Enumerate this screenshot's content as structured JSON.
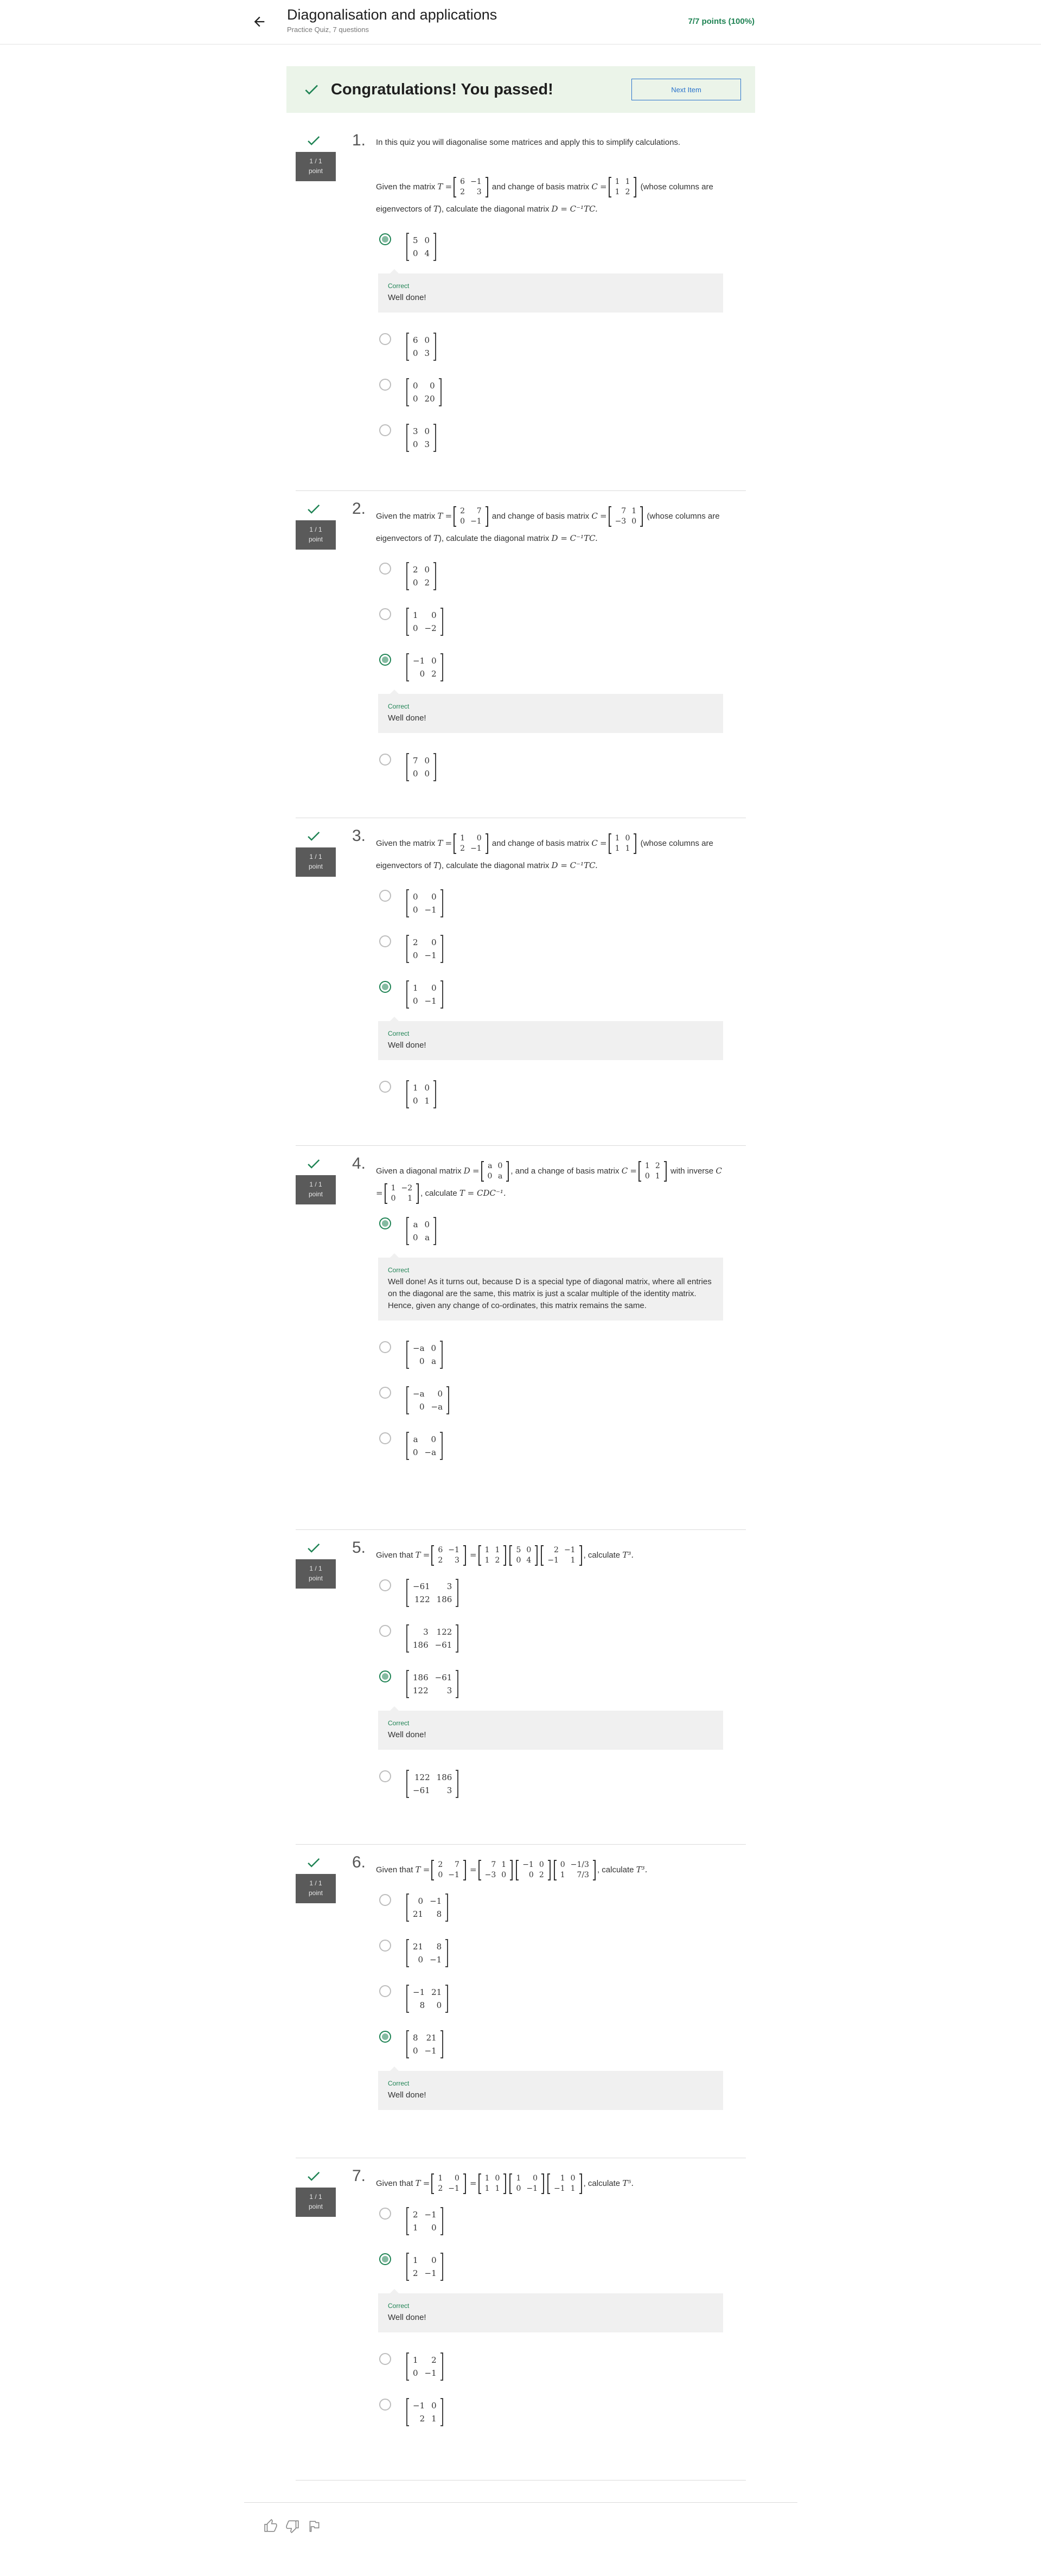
{
  "header": {
    "title": "Diagonalisation and applications",
    "subtitle": "Practice Quiz, 7 questions",
    "points": "7/7 points (100%)"
  },
  "banner": {
    "text": "Congratulations! You passed!",
    "next_label": "Next Item"
  },
  "point_label": "1 / 1",
  "point_unit": "point",
  "feedback_label": "Correct",
  "questions": [
    {
      "num": "1.",
      "intro": "In this quiz you will diagonalise some matrices and apply this to simplify calculations.",
      "options": [
        {
          "m": [
            [
              "5",
              "0"
            ],
            [
              "0",
              "4"
            ]
          ],
          "selected": true,
          "feedback": "Well done!"
        },
        {
          "m": [
            [
              "6",
              "0"
            ],
            [
              "0",
              "3"
            ]
          ],
          "selected": false
        },
        {
          "m": [
            [
              "0",
              "0"
            ],
            [
              "0",
              "20"
            ]
          ],
          "selected": false
        },
        {
          "m": [
            [
              "3",
              "0"
            ],
            [
              "0",
              "3"
            ]
          ],
          "selected": false
        }
      ]
    },
    {
      "num": "2.",
      "options": [
        {
          "m": [
            [
              "2",
              "0"
            ],
            [
              "0",
              "2"
            ]
          ],
          "selected": false
        },
        {
          "m": [
            [
              "1",
              "0"
            ],
            [
              "0",
              "−2"
            ]
          ],
          "selected": false
        },
        {
          "m": [
            [
              "−1",
              "0"
            ],
            [
              "0",
              "2"
            ]
          ],
          "selected": true,
          "feedback": "Well done!"
        },
        {
          "m": [
            [
              "7",
              "0"
            ],
            [
              "0",
              "0"
            ]
          ],
          "selected": false
        }
      ]
    },
    {
      "num": "3.",
      "options": [
        {
          "m": [
            [
              "0",
              "0"
            ],
            [
              "0",
              "−1"
            ]
          ],
          "selected": false
        },
        {
          "m": [
            [
              "2",
              "0"
            ],
            [
              "0",
              "−1"
            ]
          ],
          "selected": false
        },
        {
          "m": [
            [
              "1",
              "0"
            ],
            [
              "0",
              "−1"
            ]
          ],
          "selected": true,
          "feedback": "Well done!"
        },
        {
          "m": [
            [
              "1",
              "0"
            ],
            [
              "0",
              "1"
            ]
          ],
          "selected": false
        }
      ]
    },
    {
      "num": "4.",
      "options": [
        {
          "m": [
            [
              "a",
              "0"
            ],
            [
              "0",
              "a"
            ]
          ],
          "selected": true,
          "feedback": "Well done! As it turns out, because D is a special type of diagonal matrix, where all entries on the diagonal are the same, this matrix is just a scalar multiple of the identity matrix. Hence, given any change of co-ordinates, this matrix remains the same."
        },
        {
          "m": [
            [
              "−a",
              "0"
            ],
            [
              "0",
              "a"
            ]
          ],
          "selected": false
        },
        {
          "m": [
            [
              "−a",
              "0"
            ],
            [
              "0",
              "−a"
            ]
          ],
          "selected": false
        },
        {
          "m": [
            [
              "a",
              "0"
            ],
            [
              "0",
              "−a"
            ]
          ],
          "selected": false
        }
      ]
    },
    {
      "num": "5.",
      "options": [
        {
          "m": [
            [
              "−61",
              "3"
            ],
            [
              "122",
              "186"
            ]
          ],
          "selected": false
        },
        {
          "m": [
            [
              "3",
              "122"
            ],
            [
              "186",
              "−61"
            ]
          ],
          "selected": false
        },
        {
          "m": [
            [
              "186",
              "−61"
            ],
            [
              "122",
              "3"
            ]
          ],
          "selected": true,
          "feedback": "Well done!"
        },
        {
          "m": [
            [
              "122",
              "186"
            ],
            [
              "−61",
              "3"
            ]
          ],
          "selected": false
        }
      ]
    },
    {
      "num": "6.",
      "options": [
        {
          "m": [
            [
              "0",
              "−1"
            ],
            [
              "21",
              "8"
            ]
          ],
          "selected": false
        },
        {
          "m": [
            [
              "21",
              "8"
            ],
            [
              "0",
              "−1"
            ]
          ],
          "selected": false
        },
        {
          "m": [
            [
              "−1",
              "21"
            ],
            [
              "8",
              "0"
            ]
          ],
          "selected": false
        },
        {
          "m": [
            [
              "8",
              "21"
            ],
            [
              "0",
              "−1"
            ]
          ],
          "selected": true,
          "feedback": "Well done!"
        }
      ]
    },
    {
      "num": "7.",
      "options": [
        {
          "m": [
            [
              "2",
              "−1"
            ],
            [
              "1",
              "0"
            ]
          ],
          "selected": false
        },
        {
          "m": [
            [
              "1",
              "0"
            ],
            [
              "2",
              "−1"
            ]
          ],
          "selected": true,
          "feedback": "Well done!"
        },
        {
          "m": [
            [
              "1",
              "2"
            ],
            [
              "0",
              "−1"
            ]
          ],
          "selected": false
        },
        {
          "m": [
            [
              "−1",
              "0"
            ],
            [
              "2",
              "1"
            ]
          ],
          "selected": false
        }
      ]
    }
  ],
  "q_text": {
    "q1": [
      "Given the matrix",
      "T",
      "=",
      "and change of basis matrix",
      "C",
      "=",
      "(whose columns are eigenvectors of",
      "T",
      "), calculate the diagonal matrix",
      "D = C⁻¹TC."
    ],
    "q1_T": [
      [
        "6",
        "−1"
      ],
      [
        "2",
        "3"
      ]
    ],
    "q1_C": [
      [
        "1",
        "1"
      ],
      [
        "1",
        "2"
      ]
    ],
    "q2_T": [
      [
        "2",
        "7"
      ],
      [
        "0",
        "−1"
      ]
    ],
    "q2_C": [
      [
        "7",
        "1"
      ],
      [
        "−3",
        "0"
      ]
    ],
    "q3_T": [
      [
        "1",
        "0"
      ],
      [
        "2",
        "−1"
      ]
    ],
    "q3_C": [
      [
        "1",
        "0"
      ],
      [
        "1",
        "1"
      ]
    ],
    "q4": [
      "Given a diagonal matrix",
      "D",
      "=",
      "and a change of basis matrix",
      "C",
      "=",
      "with inverse",
      "C",
      "=",
      ", calculate",
      "T = CDC⁻¹."
    ],
    "q4_D": [
      [
        "a",
        "0"
      ],
      [
        "0",
        "a"
      ]
    ],
    "q4_C": [
      [
        "1",
        "2"
      ],
      [
        "0",
        "1"
      ]
    ],
    "q4_Ci": [
      [
        "1",
        "−2"
      ],
      [
        "0",
        "1"
      ]
    ],
    "q5": [
      "Given that",
      "T",
      "=",
      "=",
      ", calculate",
      "T³."
    ],
    "q5_T": [
      [
        "6",
        "−1"
      ],
      [
        "2",
        "3"
      ]
    ],
    "q5_A": [
      [
        "1",
        "1"
      ],
      [
        "1",
        "2"
      ]
    ],
    "q5_B": [
      [
        "5",
        "0"
      ],
      [
        "0",
        "4"
      ]
    ],
    "q5_Ci": [
      [
        "2",
        "−1"
      ],
      [
        "−1",
        "1"
      ]
    ],
    "q6": [
      "Given that",
      "T",
      "=",
      "=",
      ", calculate",
      "T³."
    ],
    "q6_T": [
      [
        "2",
        "7"
      ],
      [
        "0",
        "−1"
      ]
    ],
    "q6_A": [
      [
        "7",
        "1"
      ],
      [
        "−3",
        "0"
      ]
    ],
    "q6_B": [
      [
        "−1",
        "0"
      ],
      [
        "0",
        "2"
      ]
    ],
    "q6_Ci": [
      [
        "0",
        "−1/3"
      ],
      [
        "1",
        "7/3"
      ]
    ],
    "q7": [
      "Given that",
      "T",
      "=",
      "=",
      ", calculate",
      "T⁵."
    ],
    "q7_T": [
      [
        "1",
        "0"
      ],
      [
        "2",
        "−1"
      ]
    ],
    "q7_A": [
      [
        "1",
        "0"
      ],
      [
        "1",
        "1"
      ]
    ],
    "q7_B": [
      [
        "1",
        "0"
      ],
      [
        "0",
        "−1"
      ]
    ],
    "q7_Ci": [
      [
        "1",
        "0"
      ],
      [
        "−1",
        "1"
      ]
    ]
  },
  "footer_icons": [
    "thumbs-up-icon",
    "thumbs-down-icon",
    "flag-icon"
  ],
  "colors": {
    "accent_green": "#1f8354",
    "banner_bg": "#ebf4e9",
    "link_blue": "#2a73cc"
  }
}
